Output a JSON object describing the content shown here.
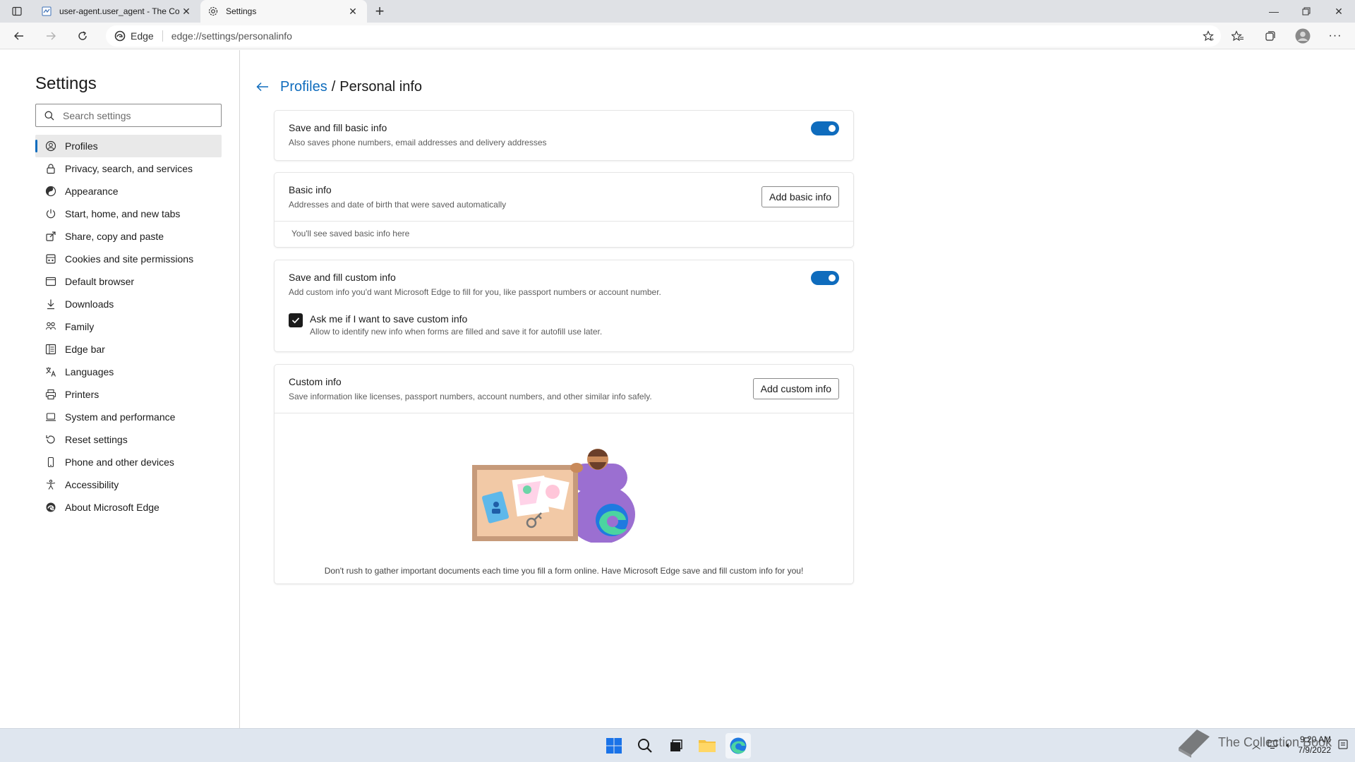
{
  "browser": {
    "tabs": [
      {
        "title": "user-agent.user_agent - The Coll",
        "favicon": "document-icon",
        "active": false
      },
      {
        "title": "Settings",
        "favicon": "gear-icon",
        "active": true
      }
    ],
    "address": {
      "label": "Edge",
      "url": "edge://settings/personalinfo"
    }
  },
  "sidebar": {
    "title": "Settings",
    "search_placeholder": "Search settings",
    "items": [
      {
        "label": "Profiles",
        "icon": "profile-icon",
        "selected": true
      },
      {
        "label": "Privacy, search, and services",
        "icon": "lock-icon"
      },
      {
        "label": "Appearance",
        "icon": "appearance-icon"
      },
      {
        "label": "Start, home, and new tabs",
        "icon": "power-icon"
      },
      {
        "label": "Share, copy and paste",
        "icon": "share-icon"
      },
      {
        "label": "Cookies and site permissions",
        "icon": "cookies-icon"
      },
      {
        "label": "Default browser",
        "icon": "browser-icon"
      },
      {
        "label": "Downloads",
        "icon": "download-icon"
      },
      {
        "label": "Family",
        "icon": "family-icon"
      },
      {
        "label": "Edge bar",
        "icon": "edge-bar-icon"
      },
      {
        "label": "Languages",
        "icon": "languages-icon"
      },
      {
        "label": "Printers",
        "icon": "printer-icon"
      },
      {
        "label": "System and performance",
        "icon": "laptop-icon"
      },
      {
        "label": "Reset settings",
        "icon": "reset-icon"
      },
      {
        "label": "Phone and other devices",
        "icon": "phone-icon"
      },
      {
        "label": "Accessibility",
        "icon": "accessibility-icon"
      },
      {
        "label": "About Microsoft Edge",
        "icon": "edge-logo-icon"
      }
    ]
  },
  "main": {
    "breadcrumb": {
      "parent": "Profiles",
      "separator": "/",
      "current": "Personal info"
    },
    "basic_fill": {
      "title": "Save and fill basic info",
      "subtitle": "Also saves phone numbers, email addresses and delivery addresses",
      "enabled": true
    },
    "basic_info": {
      "title": "Basic info",
      "subtitle": "Addresses and date of birth that were saved automatically",
      "button": "Add basic info",
      "empty": "You'll see saved basic info here"
    },
    "custom_fill": {
      "title": "Save and fill custom info",
      "subtitle": "Add custom info you'd want Microsoft Edge to fill for you, like passport numbers or account number.",
      "enabled": true,
      "ask": {
        "label": "Ask me if I want to save custom info",
        "sublabel": "Allow to identify new info when forms are filled and save it for autofill use later.",
        "checked": true
      }
    },
    "custom_info": {
      "title": "Custom info",
      "subtitle": "Save information like licenses, passport numbers, account numbers, and other similar info safely.",
      "button": "Add custom info",
      "footer": "Don't rush to gather important documents each time you fill a form online. Have Microsoft Edge save and fill custom info for you!"
    }
  },
  "taskbar": {
    "time": "9:20 AM",
    "date": "7/9/2022",
    "watermark": "The Collection Book"
  },
  "colors": {
    "accent": "#0f6cbd",
    "tabstrip": "#dfe1e5",
    "toolbar": "#f7f7f7"
  }
}
